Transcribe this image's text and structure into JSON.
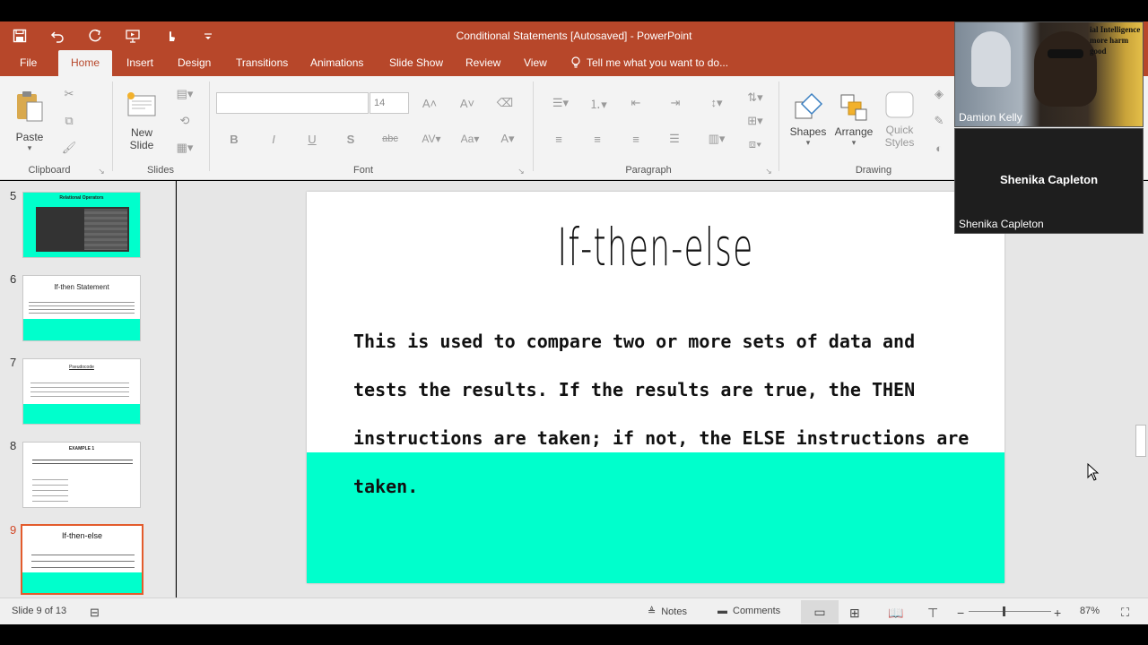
{
  "window": {
    "title": "Conditional Statements [Autosaved] - PowerPoint"
  },
  "colors": {
    "accent": "#b7472a",
    "slide_teal": "#00ffcc",
    "selected_thumb": "#e35b2c"
  },
  "tabs": [
    {
      "label": "File"
    },
    {
      "label": "Home"
    },
    {
      "label": "Insert"
    },
    {
      "label": "Design"
    },
    {
      "label": "Transitions"
    },
    {
      "label": "Animations"
    },
    {
      "label": "Slide Show"
    },
    {
      "label": "Review"
    },
    {
      "label": "View"
    }
  ],
  "tellme": {
    "placeholder": "Tell me what you want to do..."
  },
  "ribbon": {
    "clipboard": {
      "paste": "Paste",
      "label": "Clipboard"
    },
    "slides": {
      "new_slide_line1": "New",
      "new_slide_line2": "Slide",
      "label": "Slides"
    },
    "font": {
      "size": "14",
      "label": "Font"
    },
    "paragraph": {
      "label": "Paragraph"
    },
    "drawing": {
      "shapes": "Shapes",
      "arrange": "Arrange",
      "quick_line1": "Quick",
      "quick_line2": "Styles",
      "label": "Drawing"
    }
  },
  "thumbnails": [
    {
      "number": "5",
      "title": "Relational Operators"
    },
    {
      "number": "6",
      "title": "If-then Statement"
    },
    {
      "number": "7",
      "title": "Pseudocode"
    },
    {
      "number": "8",
      "title": "EXAMPLE 1"
    },
    {
      "number": "9",
      "title": "If-then-else"
    }
  ],
  "slide": {
    "title": "If-then-else",
    "body": "This is used to compare two or more sets of data and tests the results. If the results are true, the THEN instructions are taken; if not, the ELSE instructions are taken."
  },
  "statusbar": {
    "slide_indicator": "Slide 9 of 13",
    "notes": "Notes",
    "comments": "Comments",
    "zoom": "87%"
  },
  "video": {
    "tile1_name": "Damion Kelly",
    "tile1_bg_text": "ial Intelligence more harm good",
    "tile2_center": "Shenika Capleton",
    "tile2_name": "Shenika Capleton"
  }
}
